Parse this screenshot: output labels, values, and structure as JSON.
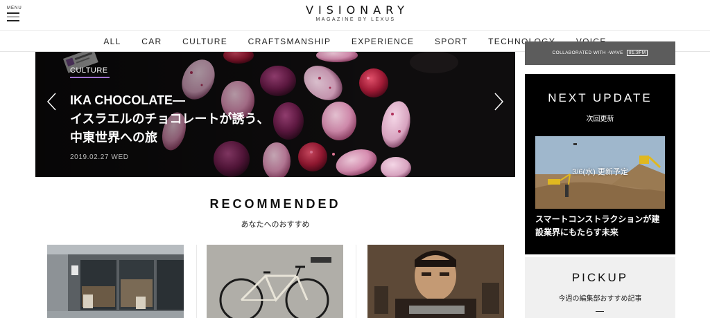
{
  "header": {
    "menu_label": "MENU",
    "logo": "VISIONARY",
    "logo_sub": "MAGAZINE BY LEXUS"
  },
  "nav": {
    "items": [
      "ALL",
      "CAR",
      "CULTURE",
      "CRAFTSMANSHIP",
      "EXPERIENCE",
      "SPORT",
      "TECHNOLOGY",
      "VOICE"
    ]
  },
  "hero": {
    "category": "CULTURE",
    "title_line1": "IKA CHOCOLATE—",
    "title_line2": "イスラエルのチョコレートが誘う、",
    "title_line3": "中東世界への旅",
    "date": "2019.02.27 WED"
  },
  "recommended": {
    "title": "RECOMMENDED",
    "subtitle": "あなたへのおすすめ"
  },
  "sidebar": {
    "banner_prefix": "COLLABORATED WITH",
    "banner_station": "-WAVE",
    "banner_freq": "81.3FM",
    "next_update_title": "NEXT UPDATE",
    "next_update_sub": "次回更新",
    "next_update_image_label": "3/6(水) 更新予定",
    "next_update_caption": "スマートコンストラクションが建設業界にもたらす未来",
    "pickup_title": "PICKUP",
    "pickup_sub": "今週の編集部おすすめ記事"
  },
  "colors": {
    "accent_purple": "#a070d0",
    "sidebar_black": "#000000",
    "pickup_bg": "#f0f0f0"
  }
}
